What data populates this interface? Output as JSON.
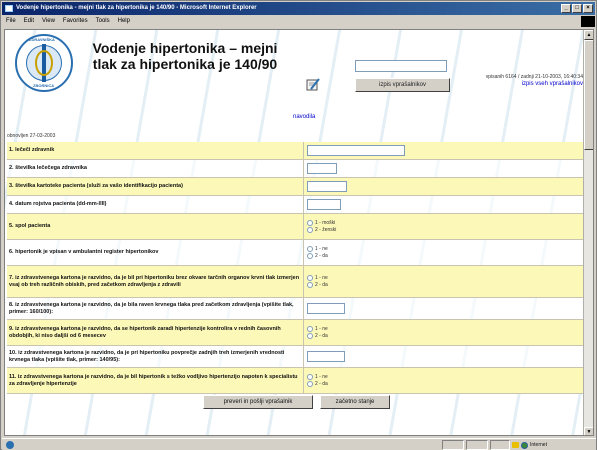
{
  "window": {
    "title": "Vodenje hipertonika - mejni tlak za hipertonika je 140/90 - Microsoft Internet Explorer",
    "controls": {
      "minimize": "_",
      "maximize": "□",
      "close": "×"
    }
  },
  "menu": [
    "File",
    "Edit",
    "View",
    "Favorites",
    "Tools",
    "Help"
  ],
  "header": {
    "seal_text_top": "ZDRAVNIŠKA",
    "seal_text_bottom": "ZBORNICA",
    "title": "Vodenje hipertonika – mejni tlak za hipertonika je 140/90",
    "submit_questions_label": "izpis vprašalnikov",
    "visit_info": "vpisanih 6164 / zadnji 21-10-2003, 16:40:34",
    "all_questions_link": "izpis vseh vprašalnikov",
    "instructions_link": "navodila",
    "updated": "obnovljen 27-03-2003"
  },
  "form": {
    "rows": [
      {
        "label": "1. lečeči zdravnik",
        "type": "text",
        "width": "wide"
      },
      {
        "label": "2. številka lečečega zdravnika",
        "type": "text",
        "width": "short"
      },
      {
        "label": "3. številka kartoteke pacienta (služi za vašo identifikacijo pacienta)",
        "type": "text",
        "width": "short"
      },
      {
        "label": "4. datum rojstva pacienta (dd-mm-llll)",
        "type": "text",
        "width": "mid"
      },
      {
        "label": "5. spol pacienta",
        "type": "radio",
        "options": [
          "1 - moški",
          "2 - ženski"
        ]
      },
      {
        "label": "6. hipertonik je vpisan v ambulantni register hipertonikov",
        "type": "radio",
        "options": [
          "1 - ne",
          "2 - da"
        ]
      },
      {
        "label": "7. iz zdravstvenega kartona je razvidno, da je bil pri hipertoniku brez okvare tarčnih organov krvni tlak izmerjen vsaj ob treh različnih obiskih, pred začetkom zdravljenja z zdravili",
        "type": "radio",
        "options": [
          "1 - ne",
          "2 - da"
        ]
      },
      {
        "label": "8. iz zdravstvenega kartona je razvidno, da je bila raven krvnega tlaka pred začetkom zdravljenja (vpišite tlak, primer: 160/100):",
        "type": "text",
        "width": "mid"
      },
      {
        "label": "9. iz zdravstvenega kartona je razvidno, da se hipertonik zaradi hipertenzije kontrolira v rednih časovnih obdobjih, ki niso daljši od 6 mesecev",
        "type": "radio",
        "options": [
          "1 - ne",
          "2 - da"
        ]
      },
      {
        "label": "10. iz zdravstvenega kartona je razvidno, da je pri hipertoniku povprečje zadnjih treh izmerjenih vrednosti krvnega tlaka (vpišite tlak, primer: 140/95):",
        "type": "text",
        "width": "mid"
      },
      {
        "label": "11. iz zdravstvenega kartona je razvidno, da je bil hipertonik s težko vodljivo hipertenzijo napoten k specialistu za zdravljenje hipertenzije",
        "type": "radio",
        "options": [
          "1 - ne",
          "2 - da"
        ]
      }
    ]
  },
  "actions": {
    "submit_label": "preveri in pošlji vprašalnik",
    "reset_label": "začetno stanje"
  },
  "statusbar": {
    "zone": "Internet"
  },
  "colors": {
    "row_highlight": "#fcf8b8",
    "link": "#0000cc",
    "titlebar": "#0a246a"
  }
}
